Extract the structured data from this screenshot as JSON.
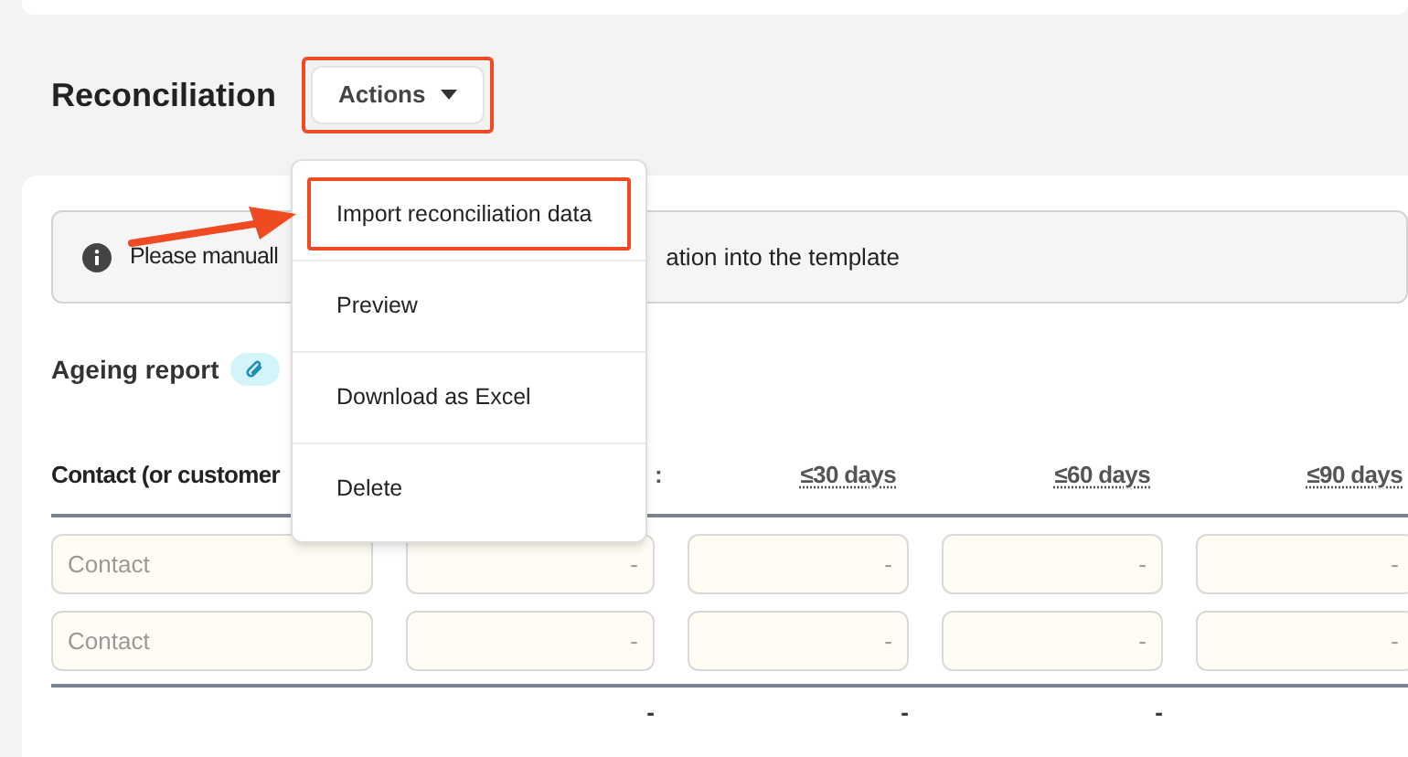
{
  "heading": "Reconciliation",
  "actions_button": {
    "label": "Actions",
    "expanded": true,
    "highlighted": true
  },
  "menu": {
    "items": [
      {
        "label": "Import reconciliation data",
        "highlighted": true
      },
      {
        "label": "Preview",
        "highlighted": false
      },
      {
        "label": "Download as Excel",
        "highlighted": false
      },
      {
        "label": "Delete",
        "highlighted": false
      }
    ]
  },
  "info_banner": {
    "text_start": "Please manuall",
    "text_end": "ation into the template"
  },
  "ageing_report": {
    "title": "Ageing report"
  },
  "table": {
    "columns": [
      "Contact (or customer",
      ":",
      "≤30 days",
      "≤60 days",
      "≤90 days"
    ],
    "rows": [
      {
        "cells": [
          {
            "placeholder": "Contact"
          },
          {
            "placeholder": "-"
          },
          {
            "placeholder": "-"
          },
          {
            "placeholder": "-"
          },
          {
            "placeholder": "-"
          }
        ]
      },
      {
        "cells": [
          {
            "placeholder": "Contact"
          },
          {
            "placeholder": "-"
          },
          {
            "placeholder": "-"
          },
          {
            "placeholder": "-"
          },
          {
            "placeholder": "-"
          }
        ]
      }
    ],
    "totals": [
      "-",
      "-",
      "-"
    ]
  }
}
